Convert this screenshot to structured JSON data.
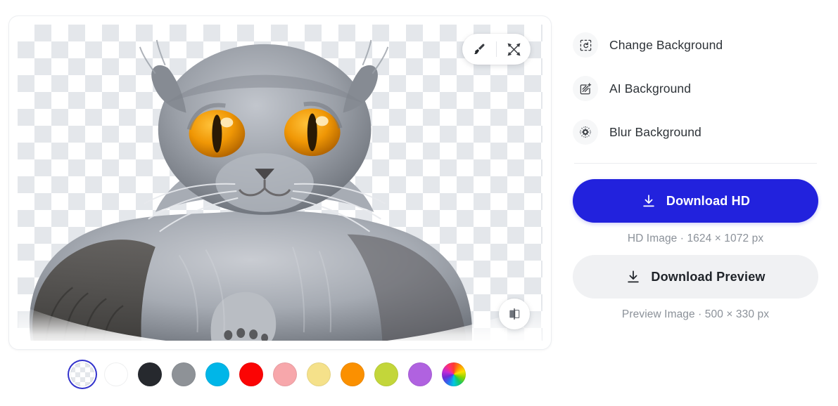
{
  "editor": {
    "canvas": {
      "background_state": "transparent-checkerboard",
      "subject": "scottish-fold-cat",
      "tools": [
        {
          "name": "brush-tool",
          "icon": "brush-icon"
        },
        {
          "name": "magic-tools",
          "icon": "crossed-tools-icon"
        }
      ],
      "compare": {
        "name": "compare-toggle",
        "icon": "compare-split-icon"
      }
    },
    "swatches": [
      {
        "name": "transparent",
        "type": "transparent",
        "color": ""
      },
      {
        "name": "white",
        "type": "solid",
        "color": "#ffffff"
      },
      {
        "name": "black",
        "type": "solid",
        "color": "#26292e"
      },
      {
        "name": "gray",
        "type": "solid",
        "color": "#8e9297"
      },
      {
        "name": "cyan",
        "type": "solid",
        "color": "#00b6e8"
      },
      {
        "name": "red",
        "type": "solid",
        "color": "#fb0404"
      },
      {
        "name": "pink",
        "type": "solid",
        "color": "#f7a7ab"
      },
      {
        "name": "yellow",
        "type": "solid",
        "color": "#f5e18a"
      },
      {
        "name": "orange",
        "type": "solid",
        "color": "#fb9000"
      },
      {
        "name": "lime",
        "type": "solid",
        "color": "#c3d63a"
      },
      {
        "name": "purple",
        "type": "solid",
        "color": "#b062e0"
      },
      {
        "name": "custom",
        "type": "rainbow",
        "color": ""
      }
    ],
    "selected_swatch_index": 0
  },
  "sidebar": {
    "actions": [
      {
        "label": "Change Background",
        "icon": "replace-image-icon",
        "name": "change-background"
      },
      {
        "label": "AI Background",
        "icon": "magic-square-icon",
        "name": "ai-background"
      },
      {
        "label": "Blur Background",
        "icon": "blur-dots-icon",
        "name": "blur-background"
      }
    ],
    "download_hd": {
      "label": "Download HD",
      "caption": "HD Image · 1624 × 1072 px",
      "icon": "download-icon",
      "color": "#2222dd",
      "text_color": "#ffffff"
    },
    "download_preview": {
      "label": "Download Preview",
      "caption": "Preview Image · 500 × 330 px",
      "icon": "download-icon",
      "color": "#f0f1f3",
      "text_color": "#20242a"
    }
  }
}
